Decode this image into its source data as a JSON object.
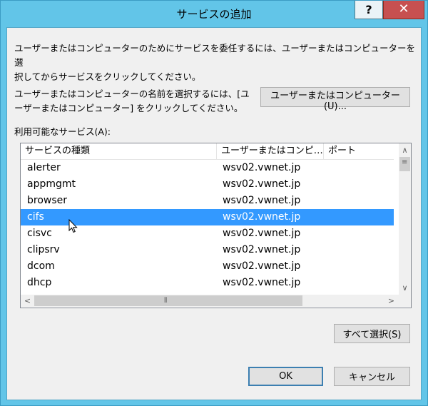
{
  "window": {
    "title": "サービスの追加",
    "help_label": "?",
    "close_label": "✕"
  },
  "instructions": {
    "line1": "ユーザーまたはコンピューターのためにサービスを委任するには、ユーザーまたはコンピューターを選",
    "line2": "択してからサービスをクリックしてください。",
    "select_line1": "ユーザーまたはコンピューターの名前を選択するには、[ユ",
    "select_line2": "ーザーまたはコンピューター] をクリックしてください。",
    "select_button": "ユーザーまたはコンピューター(U)..."
  },
  "services": {
    "label": "利用可能なサービス(A):",
    "columns": [
      "サービスの種類",
      "ユーザーまたはコンピ…",
      "ポート"
    ],
    "rows": [
      {
        "type": "alerter",
        "host": "wsv02.vwnet.jp",
        "port": ""
      },
      {
        "type": "appmgmt",
        "host": "wsv02.vwnet.jp",
        "port": ""
      },
      {
        "type": "browser",
        "host": "wsv02.vwnet.jp",
        "port": ""
      },
      {
        "type": "cifs",
        "host": "wsv02.vwnet.jp",
        "port": ""
      },
      {
        "type": "cisvc",
        "host": "wsv02.vwnet.jp",
        "port": ""
      },
      {
        "type": "clipsrv",
        "host": "wsv02.vwnet.jp",
        "port": ""
      },
      {
        "type": "dcom",
        "host": "wsv02.vwnet.jp",
        "port": ""
      },
      {
        "type": "dhcp",
        "host": "wsv02.vwnet.jp",
        "port": ""
      }
    ],
    "selected_index": 3
  },
  "buttons": {
    "select_all": "すべて選択(S)",
    "ok": "OK",
    "cancel": "キャンセル"
  },
  "colors": {
    "frame": "#62c5e8",
    "selection": "#3399ff",
    "close": "#c75050"
  }
}
